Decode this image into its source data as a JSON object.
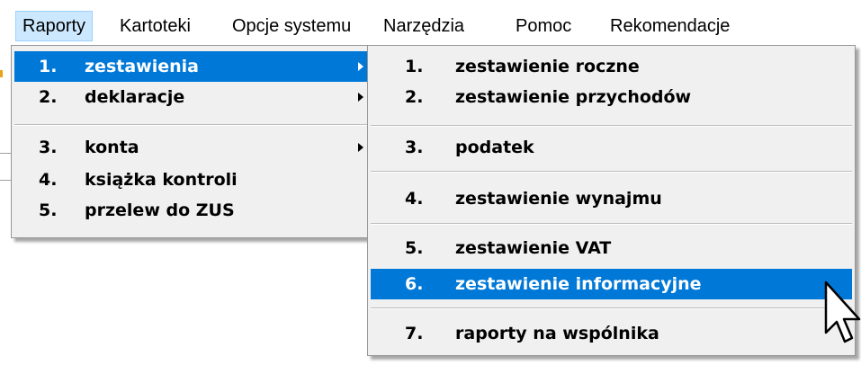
{
  "menubar": {
    "items": [
      {
        "label": "Raporty",
        "active": true
      },
      {
        "label": "Kartoteki"
      },
      {
        "label": "Opcje systemu"
      },
      {
        "label": "Narzędzia"
      },
      {
        "label": "Pomoc"
      },
      {
        "label": "Rekomendacje"
      }
    ]
  },
  "raporty_menu": {
    "items": [
      {
        "num": "1.",
        "label": "zestawienia",
        "has_submenu": true,
        "highlighted": true
      },
      {
        "num": "2.",
        "label": "deklaracje",
        "has_submenu": true
      },
      {
        "num": "3.",
        "label": "konta",
        "has_submenu": true
      },
      {
        "num": "4.",
        "label": "książka kontroli"
      },
      {
        "num": "5.",
        "label": "przelew do ZUS"
      }
    ]
  },
  "zestawienia_submenu": {
    "items": [
      {
        "num": "1.",
        "label": "zestawienie roczne"
      },
      {
        "num": "2.",
        "label": "zestawienie przychodów"
      },
      {
        "num": "3.",
        "label": "podatek"
      },
      {
        "num": "4.",
        "label": "zestawienie wynajmu"
      },
      {
        "num": "5.",
        "label": "zestawienie VAT"
      },
      {
        "num": "6.",
        "label": "zestawienie informacyjne",
        "highlighted": true
      },
      {
        "num": "7.",
        "label": "raporty na wspólnika"
      }
    ]
  },
  "colors": {
    "highlight": "#0078d7",
    "menu_background": "#f0f0f0",
    "menubar_active": "#cce8ff"
  },
  "icons": {
    "submenu_arrow": "triangle-right-icon",
    "cursor": "arrow-cursor-icon"
  }
}
